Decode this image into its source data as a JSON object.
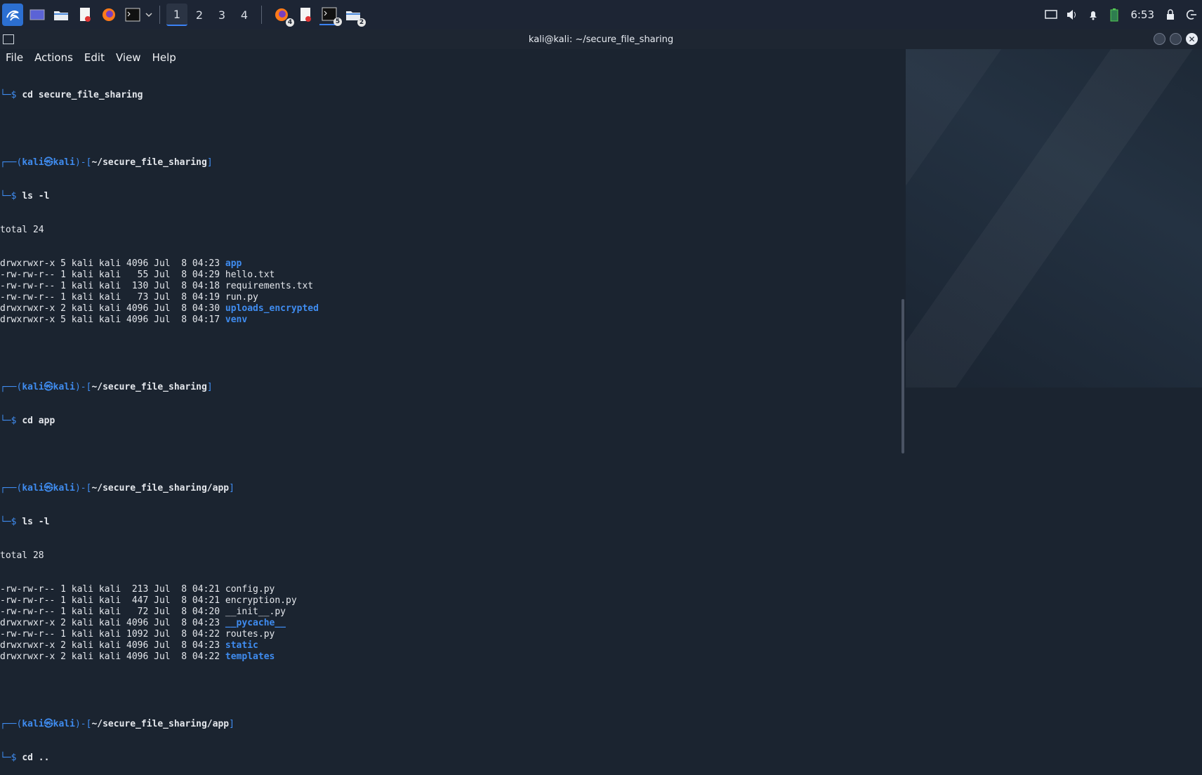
{
  "taskbar": {
    "workspaces": [
      "1",
      "2",
      "3",
      "4"
    ],
    "badges": {
      "firefox_group": "4",
      "terminal_group": "5",
      "files_group": "2"
    },
    "clock": "6:53"
  },
  "window": {
    "title": "kali@kali: ~/secure_file_sharing"
  },
  "menu": [
    "File",
    "Actions",
    "Edit",
    "View",
    "Help"
  ],
  "prompt": {
    "user": "kali",
    "host": "kali",
    "symbol": "㉿"
  },
  "terminal": {
    "line0_cmd": "cd secure_file_sharing",
    "p1_path": "~/secure_file_sharing",
    "p1_cmd": "ls -l",
    "total1": "total 24",
    "ls1": [
      {
        "perm": "drwxrwxr-x 5 kali kali 4096 Jul  8 04:23 ",
        "name": "app",
        "dir": true
      },
      {
        "perm": "-rw-rw-r-- 1 kali kali   55 Jul  8 04:29 ",
        "name": "hello.txt",
        "dir": false
      },
      {
        "perm": "-rw-rw-r-- 1 kali kali  130 Jul  8 04:18 ",
        "name": "requirements.txt",
        "dir": false
      },
      {
        "perm": "-rw-rw-r-- 1 kali kali   73 Jul  8 04:19 ",
        "name": "run.py",
        "dir": false
      },
      {
        "perm": "drwxrwxr-x 2 kali kali 4096 Jul  8 04:30 ",
        "name": "uploads_encrypted",
        "dir": true
      },
      {
        "perm": "drwxrwxr-x 5 kali kali 4096 Jul  8 04:17 ",
        "name": "venv",
        "dir": true
      }
    ],
    "p2_path": "~/secure_file_sharing",
    "p2_cmd": "cd app",
    "p3_path": "~/secure_file_sharing/app",
    "p3_cmd": "ls -l",
    "total2": "total 28",
    "ls2": [
      {
        "perm": "-rw-rw-r-- 1 kali kali  213 Jul  8 04:21 ",
        "name": "config.py",
        "dir": false
      },
      {
        "perm": "-rw-rw-r-- 1 kali kali  447 Jul  8 04:21 ",
        "name": "encryption.py",
        "dir": false
      },
      {
        "perm": "-rw-rw-r-- 1 kali kali   72 Jul  8 04:20 ",
        "name": "__init__.py",
        "dir": false
      },
      {
        "perm": "drwxrwxr-x 2 kali kali 4096 Jul  8 04:23 ",
        "name": "__pycache__",
        "dir": true
      },
      {
        "perm": "-rw-rw-r-- 1 kali kali 1092 Jul  8 04:22 ",
        "name": "routes.py",
        "dir": false
      },
      {
        "perm": "drwxrwxr-x 2 kali kali 4096 Jul  8 04:23 ",
        "name": "static",
        "dir": true
      },
      {
        "perm": "drwxrwxr-x 2 kali kali 4096 Jul  8 04:22 ",
        "name": "templates",
        "dir": true
      }
    ],
    "p4_path": "~/secure_file_sharing/app",
    "p4_cmd": "cd .."
  },
  "colors": {
    "accent": "#3f8cf0",
    "background": "#1b2430",
    "text": "#e4e7ec"
  }
}
